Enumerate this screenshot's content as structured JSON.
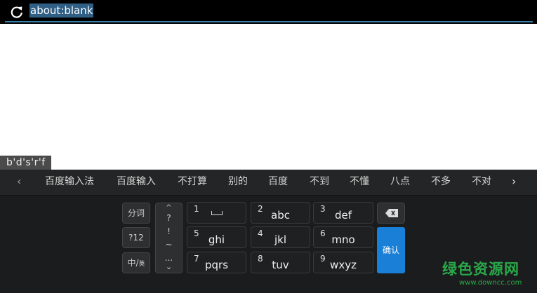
{
  "urlbar": {
    "url": "about:blank"
  },
  "composing": {
    "text": "b'd's'r'f"
  },
  "candidates": {
    "prev_arrow": "‹",
    "next_arrow": "›",
    "items": [
      "百度输入法",
      "百度输入",
      "不打算",
      "别的",
      "百度",
      "不到",
      "不懂",
      "八点",
      "不多",
      "不对"
    ]
  },
  "keyboard": {
    "left_keys": {
      "segment": "分词",
      "symbols": "?12",
      "lang_main": "中/",
      "lang_sub": "英"
    },
    "punct": [
      "^",
      "?",
      "!",
      "~",
      "...",
      "⌄"
    ],
    "keys": [
      {
        "num": "1",
        "letters": ""
      },
      {
        "num": "2",
        "letters": "abc"
      },
      {
        "num": "3",
        "letters": "def"
      },
      {
        "num": "5",
        "letters": "ghi"
      },
      {
        "num": "4",
        "letters": "jkl"
      },
      {
        "num": "6",
        "letters": "mno"
      },
      {
        "num": "7",
        "letters": "pqrs"
      },
      {
        "num": "8",
        "letters": "tuv"
      },
      {
        "num": "9",
        "letters": "wxyz"
      }
    ],
    "confirm": "确认"
  },
  "watermark": {
    "cn": "绿色资源网",
    "en": "www.downcc.com"
  },
  "colors": {
    "accent": "#1a7fd6",
    "url_highlight": "#2f5f85",
    "watermark": "#2aa84a"
  }
}
